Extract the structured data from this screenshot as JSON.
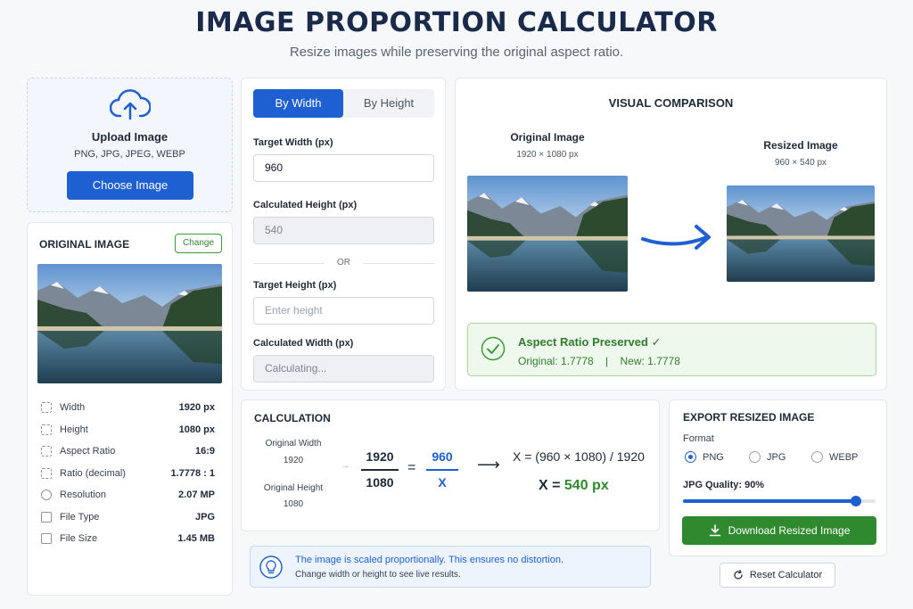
{
  "header": {
    "title": "IMAGE PROPORTION CALCULATOR",
    "subtitle": "Resize images while preserving the original aspect ratio."
  },
  "upload": {
    "icon": "cloud-upload-icon",
    "title": "Upload Image",
    "formats": "PNG, JPG, JPEG, WEBP",
    "button_label": "Choose Image"
  },
  "original": {
    "heading": "ORIGINAL IMAGE",
    "change_label": "Change",
    "image_alt": "Mountain lake landscape",
    "meta": [
      {
        "label": "Width",
        "value": "1920 px"
      },
      {
        "label": "Height",
        "value": "1080 px"
      },
      {
        "label": "Aspect Ratio",
        "value": "16:9"
      },
      {
        "label": "Ratio (decimal)",
        "value": "1.7778 : 1"
      },
      {
        "label": "Resolution",
        "value": "2.07 MP"
      },
      {
        "label": "File Type",
        "value": "JPG"
      },
      {
        "label": "File Size",
        "value": "1.45 MB"
      }
    ]
  },
  "form": {
    "tabs": [
      "By Width",
      "By Height"
    ],
    "active_tab": "By Width",
    "target_width_label": "Target Width (px)",
    "target_width_value": "960",
    "calc_height_label": "Calculated Height (px)",
    "calc_height_value": "540",
    "or_label": "OR",
    "target_height_label": "Target Height (px)",
    "target_height_placeholder": "Enter height",
    "calc_width_label": "Calculated Width (px)",
    "calc_width_value": "Calculating..."
  },
  "visual": {
    "heading": "VISUAL COMPARISON",
    "original_name": "Original Image",
    "original_dims": "1920 × 1080 px",
    "resized_name": "Resized Image",
    "resized_dims": "960 × 540 px",
    "preserved_title": "Aspect Ratio Preserved ✓",
    "preserved_detail": "Original: 1.7778    |    New: 1.7778"
  },
  "calculation": {
    "heading": "CALCULATION",
    "orig_width_label": "Original Width",
    "orig_width_value": "1920",
    "orig_height_label": "Original Height",
    "orig_height_value": "1080",
    "frac_left_top": "1920",
    "frac_left_bottom": "1080",
    "frac_right_top": "960",
    "frac_right_bottom": "X",
    "equals": "=",
    "formula": "X = (960 × 1080) / 1920",
    "result_prefix": "X = ",
    "result_value": "540 px"
  },
  "info": {
    "line1": "The image is scaled proportionally. This ensures no distortion.",
    "line2": "Change width or height to see live results."
  },
  "export": {
    "heading": "EXPORT RESIZED IMAGE",
    "format_label": "Format",
    "formats": [
      "PNG",
      "JPG",
      "WEBP"
    ],
    "selected_format": "PNG",
    "quality_label": "JPG Quality: 90%",
    "quality_value": 0.9,
    "download_label": "Download Resized Image",
    "reset_label": "Reset Calculator"
  },
  "colors": {
    "primary": "#1e5fd1",
    "success": "#2f8a2f",
    "title": "#1a2a4a"
  }
}
